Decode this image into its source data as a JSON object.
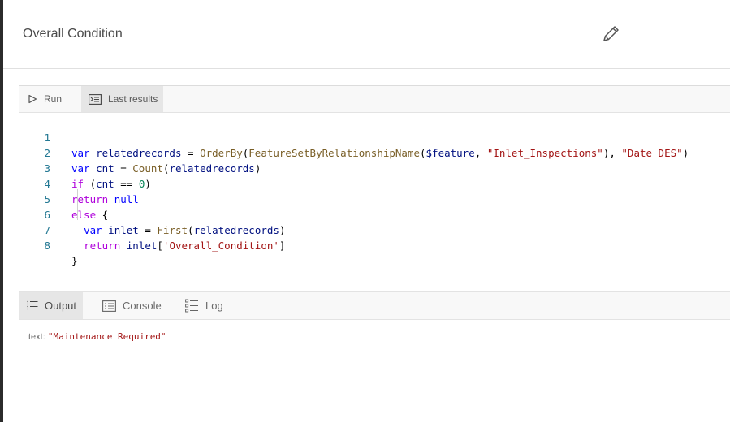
{
  "header": {
    "title": "Overall Condition",
    "edit_icon": "pencil-icon"
  },
  "toolbar": {
    "run_label": "Run",
    "last_results_label": "Last results"
  },
  "editor": {
    "line_numbers": [
      "1",
      "2",
      "3",
      "4",
      "5",
      "6",
      "7",
      "8"
    ]
  },
  "output_tabs": {
    "output_label": "Output",
    "console_label": "Console",
    "log_label": "Log"
  },
  "output": {
    "key": "text:",
    "value": "\"Maintenance Required\""
  },
  "colors": {
    "keyword": "#0000ff",
    "string": "#a31515",
    "line_number": "#237893"
  }
}
